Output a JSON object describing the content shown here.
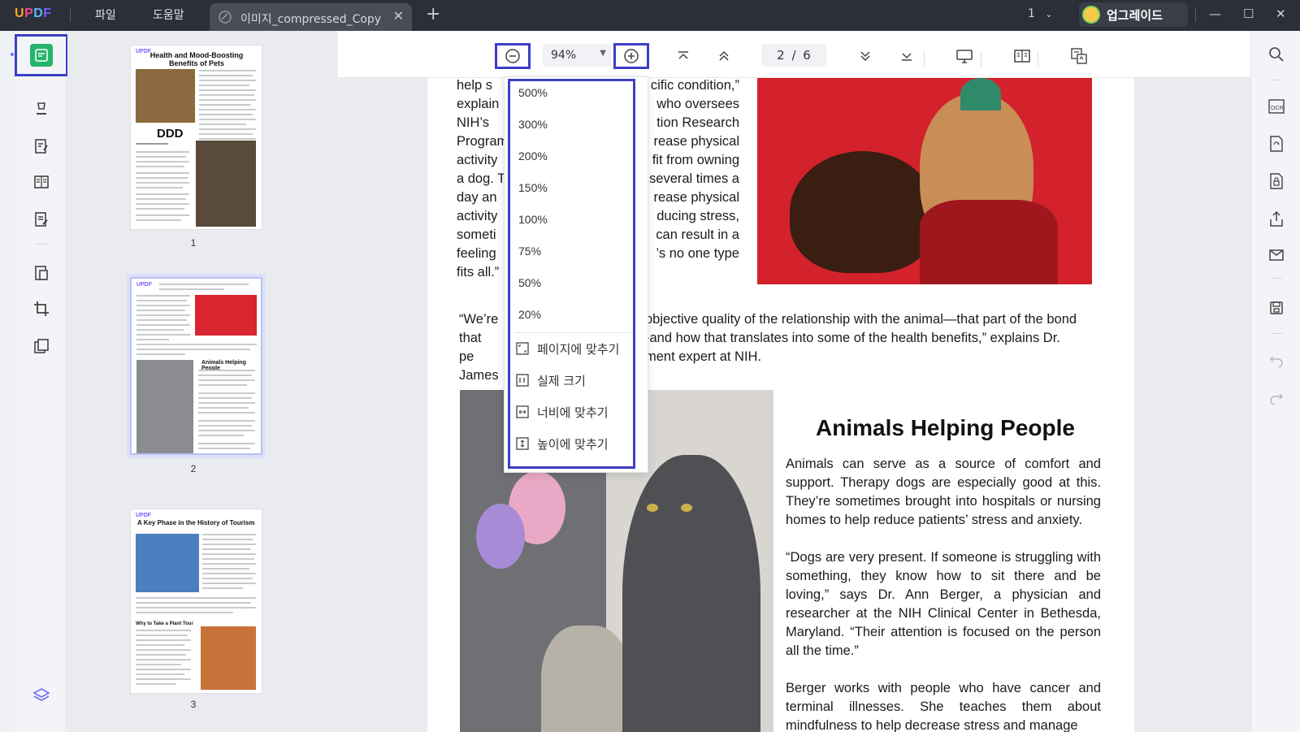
{
  "app": {
    "logo": {
      "l1": "U",
      "l2": "P",
      "l3": "D",
      "l4": "F"
    },
    "menu": {
      "file": "파일",
      "help": "도움말"
    },
    "tab": {
      "title": "이미지_compressed_Copy",
      "close": "✕"
    },
    "new_tab": "+",
    "page_indicator": "1",
    "upgrade_label": "업그레이드",
    "window": {
      "minimize": "—",
      "maximize": "☐",
      "close": "✕"
    }
  },
  "toolbar": {
    "zoom_value": "94%",
    "page_display": "2 / 6"
  },
  "zoom_menu": {
    "levels": [
      "500%",
      "300%",
      "200%",
      "150%",
      "100%",
      "75%",
      "50%",
      "20%"
    ],
    "fit_page": "페이지에 맞추기",
    "actual_size": "실제 크기",
    "fit_width": "너비에 맞추기",
    "fit_height": "높이에 맞추기"
  },
  "thumbnails": {
    "page1": {
      "logo": "UPDF",
      "title": "Health and Mood-Boosting Benefits of Pets",
      "overlay": "DDD",
      "num": "1"
    },
    "page2": {
      "logo": "UPDF",
      "heading": "Animals Helping People",
      "num": "2"
    },
    "page3": {
      "logo": "UPDF",
      "title": "A Key Phase in the History of Tourism",
      "subhead": "Why to Take a Plant Tour",
      "num": "3"
    }
  },
  "document": {
    "left_column_lines": [
      "help s",
      "explain",
      "NIH’s",
      "Program",
      "activity",
      "a dog. T",
      "day an",
      "activity",
      "someti",
      "feeling",
      "fits all.”"
    ],
    "right_column_lines": [
      "cific condition,”",
      "who oversees",
      "tion Research",
      "rease physical",
      "fit from owning",
      "several times a",
      "rease physical",
      "ducing stress,",
      "can result in a",
      "’s no one type"
    ],
    "quote_lines": [
      "“We’re",
      "objective quality of the relationship with the animal—that part of the bond",
      "that pe",
      "-and how that translates into some of the health benefits,” explains Dr.",
      "James",
      "ment expert at NIH."
    ],
    "heading": "Animals Helping People",
    "para1": "Animals can serve as a source of comfort and support. Therapy dogs are especially good at this. They’re sometimes brought into hospitals or nursing homes to help reduce patients’ stress and anxiety.",
    "para2": "“Dogs are very present. If someone is struggling with something, they know how to sit there and be loving,” says Dr. Ann Berger, a physician and researcher at the NIH Clinical Center in Bethesda, Maryland. “Their attention is focused on the person all the time.”",
    "para3": "Berger works with people who have cancer and terminal illnesses. She teaches them about mindfulness to help decrease stress and manage"
  }
}
